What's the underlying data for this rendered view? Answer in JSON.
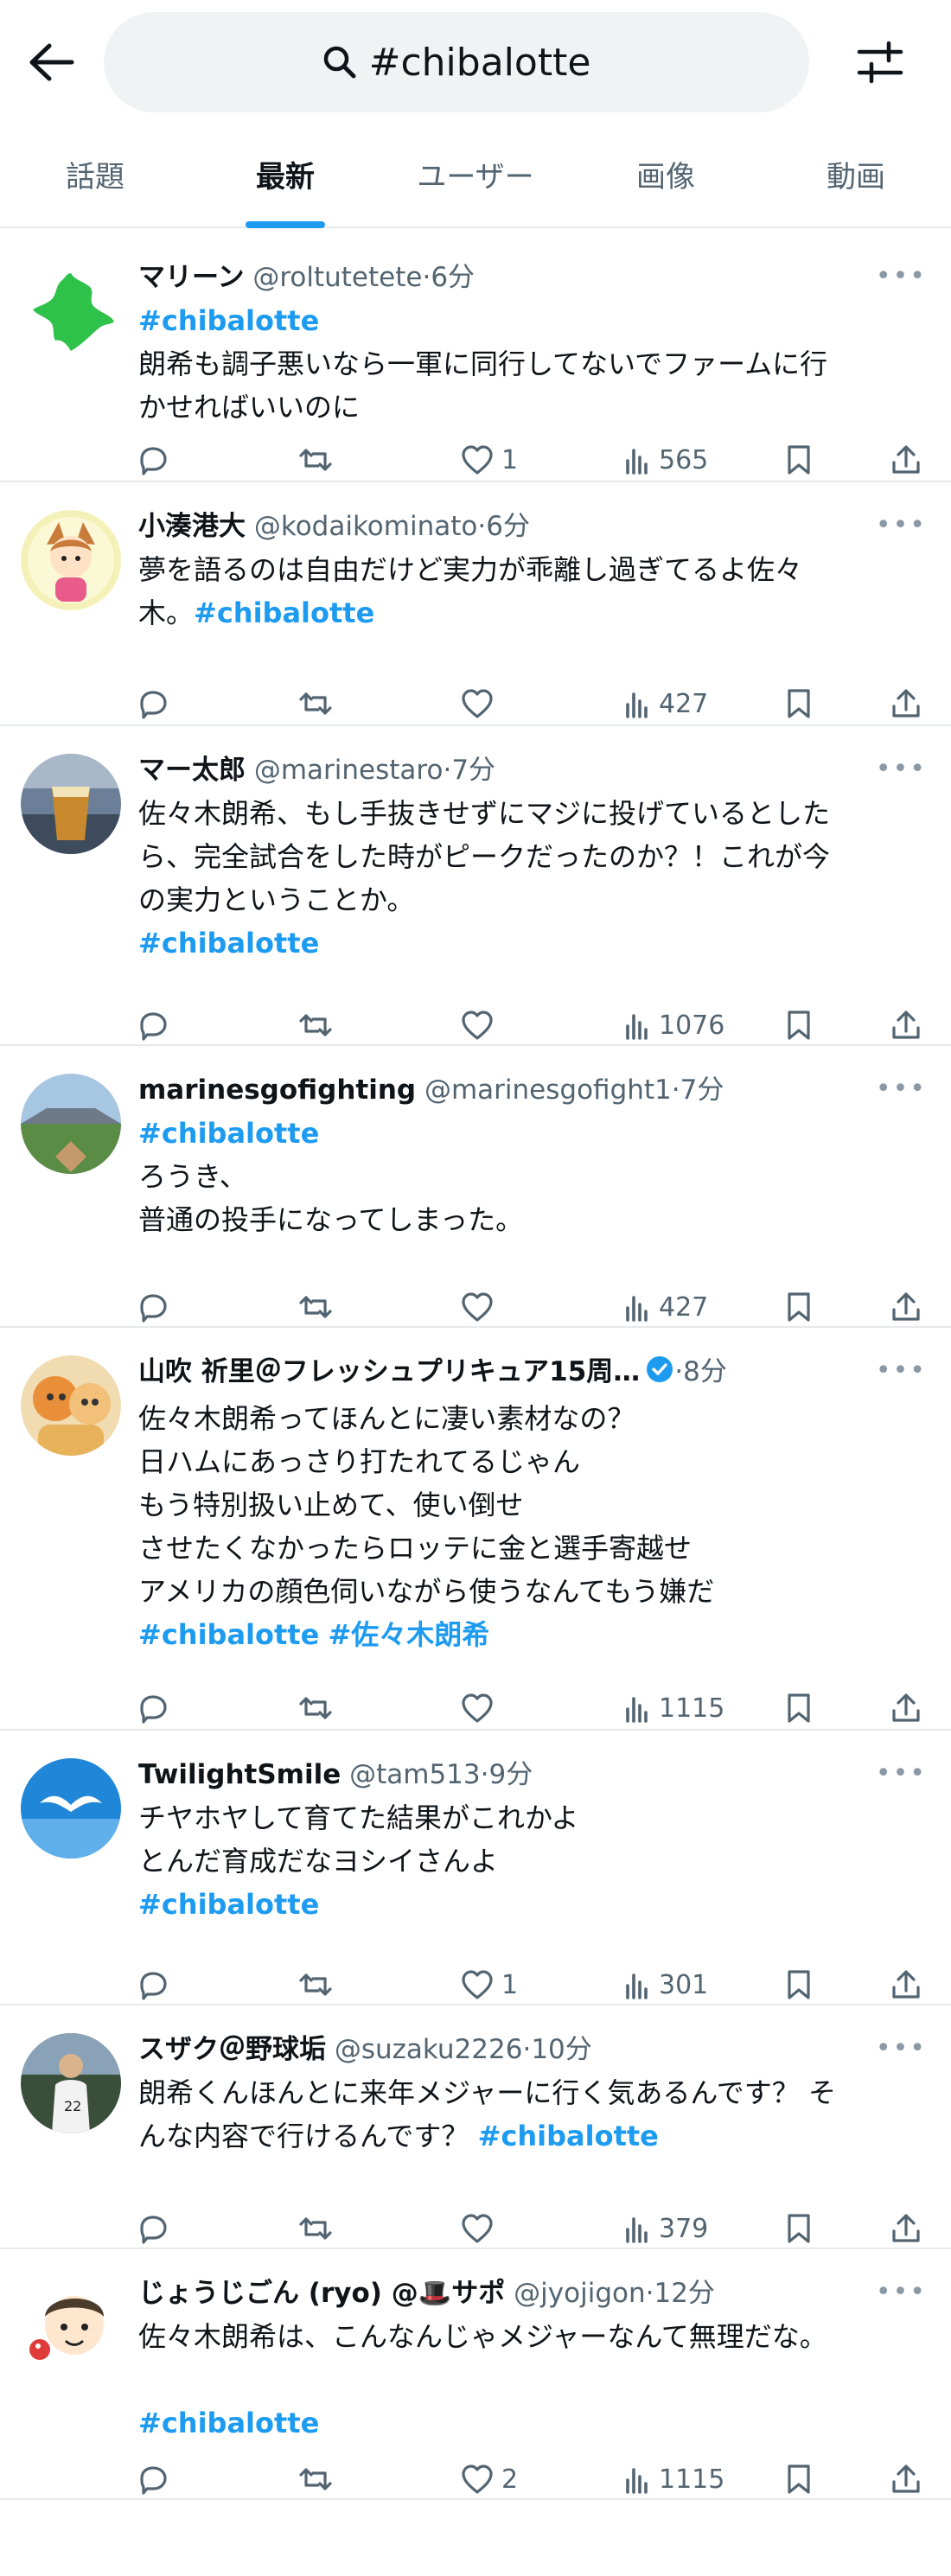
{
  "search": {
    "query": "#chibalotte"
  },
  "tabs": [
    {
      "label": "話題"
    },
    {
      "label": "最新"
    },
    {
      "label": "ユーザー"
    },
    {
      "label": "画像"
    },
    {
      "label": "動画"
    }
  ],
  "tweets": [
    {
      "name": "マリーン",
      "handle": "@roltutetete",
      "time": "6分",
      "avatar": "chiba-prefecture-map",
      "verified": false,
      "lines": [
        [
          {
            "t": "#chibalotte",
            "tag": true
          }
        ],
        [
          {
            "t": "朗希も調子悪いなら一軍に同行してないでファームに行"
          }
        ],
        [
          {
            "t": "かせればいいのに"
          }
        ]
      ],
      "replies": "",
      "likes": "1",
      "views": "565"
    },
    {
      "name": "小湊港大",
      "handle": "@kodaikominato",
      "time": "6分",
      "avatar": "anime-character",
      "verified": false,
      "lines": [
        [
          {
            "t": "夢を語るのは自由だけど実力が乖離し過ぎてるよ佐々"
          }
        ],
        [
          {
            "t": "木。"
          },
          {
            "t": "#chibalotte",
            "tag": true
          }
        ]
      ],
      "replies": "",
      "likes": "",
      "views": "427"
    },
    {
      "name": "マー太郎",
      "handle": "@marinestaro",
      "time": "7分",
      "avatar": "stadium-drink",
      "verified": false,
      "lines": [
        [
          {
            "t": "佐々木朗希、もし手抜きせずにマジに投げているとした"
          }
        ],
        [
          {
            "t": "ら、完全試合をした時がピークだったのか？！これが今"
          }
        ],
        [
          {
            "t": "の実力ということか。"
          }
        ],
        [
          {
            "t": " #chibalotte",
            "tag": true
          }
        ]
      ],
      "replies": "",
      "likes": "",
      "views": "1076"
    },
    {
      "name": "marinesgofighting",
      "handle": "@marinesgofight1",
      "time": "7分",
      "avatar": "ballpark",
      "verified": false,
      "lines": [
        [
          {
            "t": "#chibalotte",
            "tag": true
          }
        ],
        [
          {
            "t": "ろうき、"
          }
        ],
        [
          {
            "t": "普通の投手になってしまった。"
          }
        ]
      ],
      "replies": "",
      "likes": "",
      "views": "427"
    },
    {
      "name": "山吹 祈里＠フレッシュプリキュア15周…",
      "handle": "",
      "time": "8分",
      "avatar": "plush-toys",
      "verified": true,
      "lines": [
        [
          {
            "t": "佐々木朗希ってほんとに凄い素材なの？"
          }
        ],
        [
          {
            "t": "日ハムにあっさり打たれてるじゃん"
          }
        ],
        [
          {
            "t": "もう特別扱い止めて、使い倒せ"
          }
        ],
        [
          {
            "t": "させたくなかったらロッテに金と選手寄越せ"
          }
        ],
        [
          {
            "t": "アメリカの顔色伺いながら使うなんてもう嫌だ"
          }
        ],
        [
          {
            "t": "#chibalotte",
            "tag": true
          },
          {
            "t": " "
          },
          {
            "t": "#佐々木朗希",
            "tag": true
          }
        ]
      ],
      "replies": "",
      "likes": "",
      "views": "1115"
    },
    {
      "name": "TwilightSmile",
      "handle": "@tam513",
      "time": "9分",
      "avatar": "seagull-sky",
      "verified": false,
      "lines": [
        [
          {
            "t": "チヤホヤして育てた結果がこれかよ"
          }
        ],
        [
          {
            "t": "とんだ育成だなヨシイさんよ"
          }
        ],
        [
          {
            "t": " #chibalotte",
            "tag": true
          }
        ]
      ],
      "replies": "",
      "likes": "1",
      "views": "301"
    },
    {
      "name": "スザク＠野球垢",
      "handle": "@suzaku2226",
      "time": "10分",
      "avatar": "baseball-player",
      "verified": false,
      "lines": [
        [
          {
            "t": "朗希くんほんとに来年メジャーに行く気あるんです？ そ"
          }
        ],
        [
          {
            "t": "んな内容で行けるんです？ "
          },
          {
            "t": "#chibalotte",
            "tag": true
          }
        ]
      ],
      "replies": "",
      "likes": "",
      "views": "379"
    },
    {
      "name": "じょうじごん (ryo) @🎩サポ",
      "handle": "@jyojigon",
      "time": "12分",
      "avatar": "cartoon-face",
      "verified": false,
      "lines": [
        [
          {
            "t": "佐々木朗希は、こんなんじゃメジャーなんて無理だな。"
          }
        ],
        [
          {
            "t": ""
          }
        ],
        [
          {
            "t": "#chibalotte",
            "tag": true
          }
        ]
      ],
      "replies": "",
      "likes": "2",
      "views": "1115"
    }
  ],
  "icons": {
    "back": "arrow-left-icon",
    "search": "search-icon",
    "filter": "sliders-icon",
    "more": "more-icon",
    "reply": "reply-icon",
    "retweet": "retweet-icon",
    "like": "heart-icon",
    "views": "views-icon",
    "bookmark": "bookmark-icon",
    "share": "share-icon"
  },
  "colors": {
    "accent": "#1d9bf0",
    "text": "#0f1419",
    "muted": "#536471",
    "divider": "#e6e8ea",
    "pill": "#eff3f4"
  }
}
